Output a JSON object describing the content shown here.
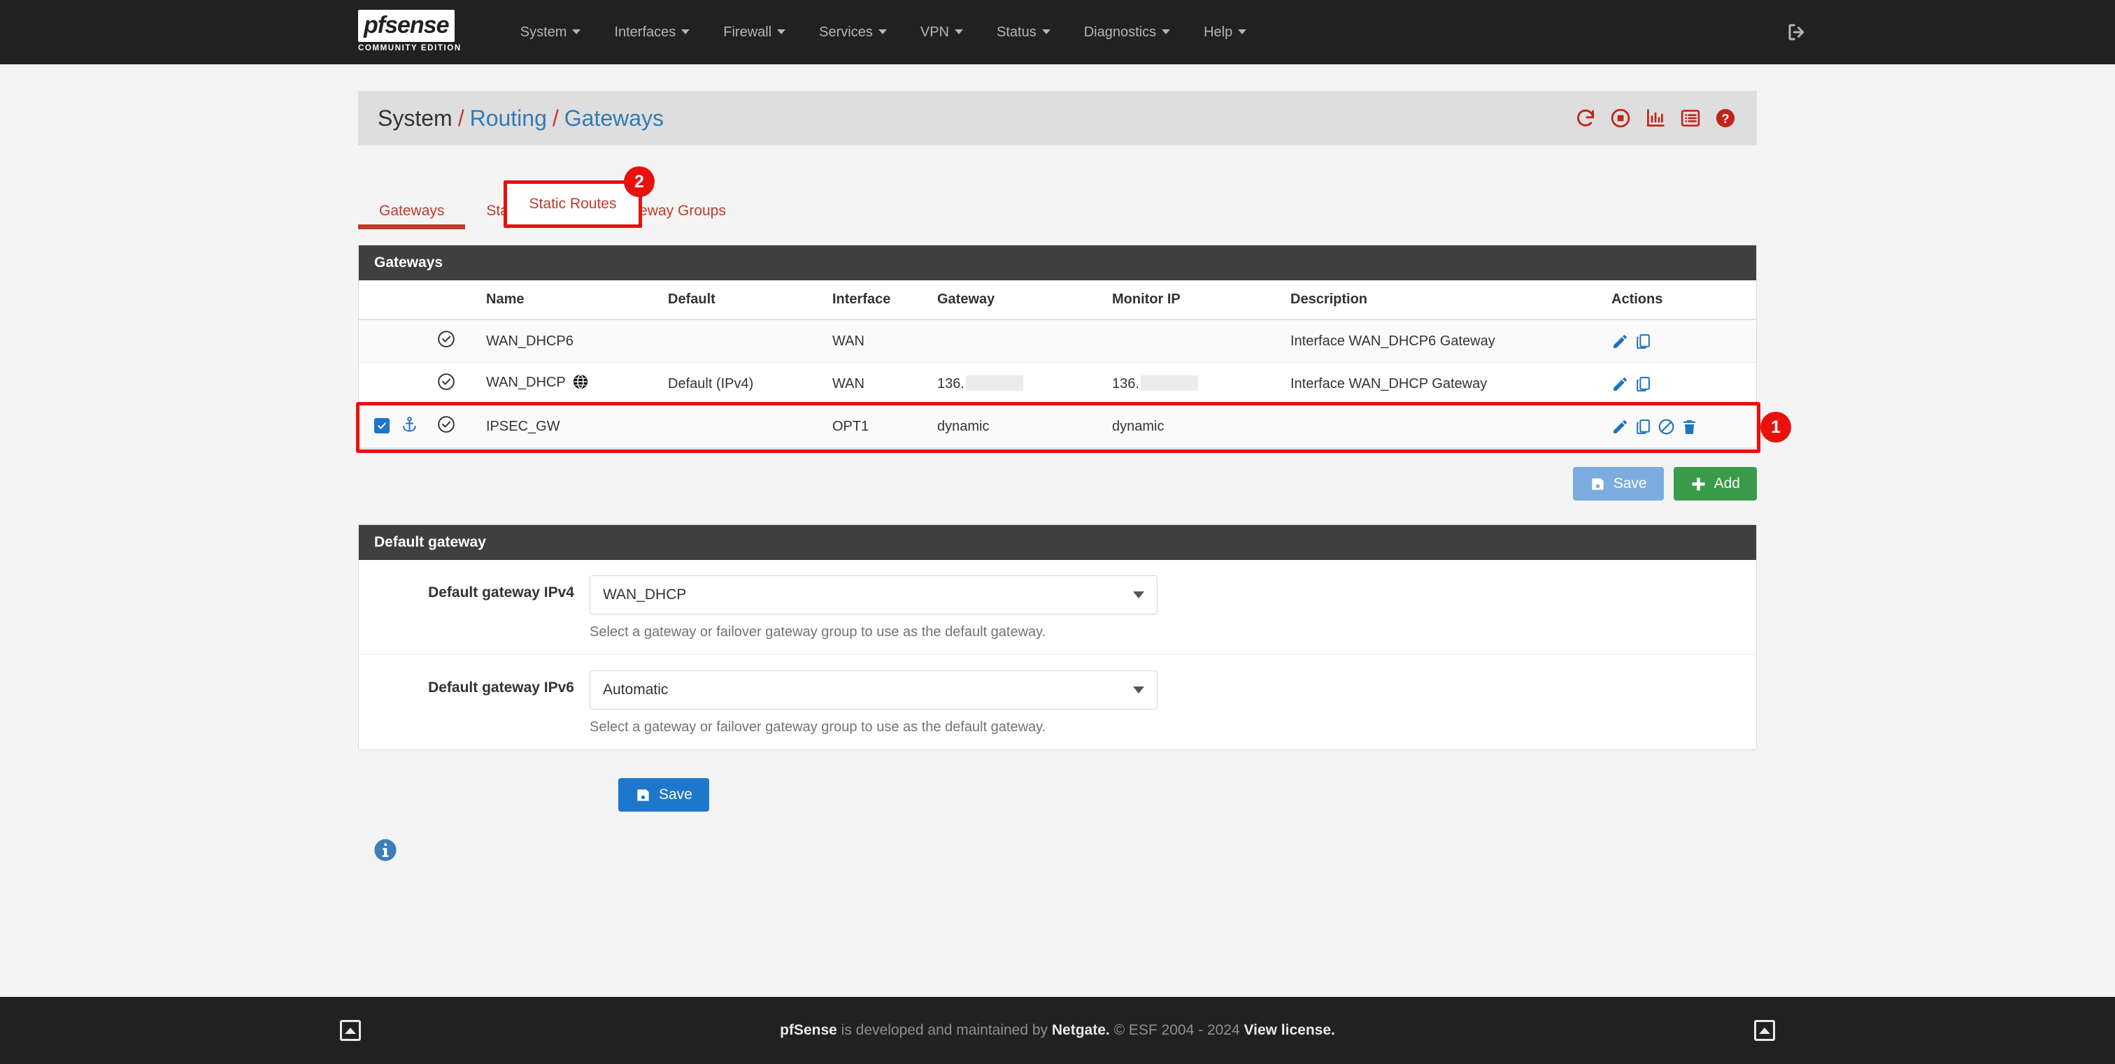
{
  "navbar": {
    "logo_text": "pfsense",
    "logo_sub": "COMMUNITY EDITION",
    "items": [
      {
        "label": "System"
      },
      {
        "label": "Interfaces"
      },
      {
        "label": "Firewall"
      },
      {
        "label": "Services"
      },
      {
        "label": "VPN"
      },
      {
        "label": "Status"
      },
      {
        "label": "Diagnostics"
      },
      {
        "label": "Help"
      }
    ],
    "logout_icon": "logout-icon"
  },
  "breadcrumb": {
    "root": "System",
    "sep": "/",
    "level2": "Routing",
    "level3": "Gateways",
    "icons": [
      {
        "name": "reload-icon"
      },
      {
        "name": "stop-icon"
      },
      {
        "name": "chart-icon"
      },
      {
        "name": "log-icon"
      },
      {
        "name": "help-icon"
      }
    ]
  },
  "tabs": [
    {
      "label": "Gateways",
      "active": true
    },
    {
      "label": "Static Routes",
      "active": false
    },
    {
      "label": "Gateway Groups",
      "active": false
    }
  ],
  "annotations": [
    {
      "number": "1",
      "target": "ipsec-gw-row"
    },
    {
      "number": "2",
      "target": "static-routes-tab"
    }
  ],
  "gateways_panel": {
    "title": "Gateways",
    "columns": [
      "",
      "",
      "",
      "Name",
      "Default",
      "Interface",
      "Gateway",
      "Monitor IP",
      "Description",
      "Actions"
    ],
    "column_headers": {
      "name": "Name",
      "default": "Default",
      "interface": "Interface",
      "gateway": "Gateway",
      "monitor_ip": "Monitor IP",
      "description": "Description",
      "actions": "Actions"
    },
    "rows": [
      {
        "checked": false,
        "anchor": false,
        "status": "status-ok-icon",
        "name": "WAN_DHCP6",
        "globe": false,
        "default": "",
        "interface": "WAN",
        "gateway": "",
        "gateway_redacted": false,
        "monitor_ip": "",
        "monitor_redacted": false,
        "description": "Interface WAN_DHCP6 Gateway",
        "actions": [
          "edit-icon",
          "copy-icon"
        ]
      },
      {
        "checked": false,
        "anchor": false,
        "status": "status-ok-icon",
        "name": "WAN_DHCP",
        "globe": true,
        "default": "Default (IPv4)",
        "interface": "WAN",
        "gateway": "136.",
        "gateway_redacted": true,
        "monitor_ip": "136.",
        "monitor_redacted": true,
        "description": "Interface WAN_DHCP Gateway",
        "actions": [
          "edit-icon",
          "copy-icon"
        ]
      },
      {
        "checked": true,
        "anchor": true,
        "status": "status-ok-icon",
        "name": "IPSEC_GW",
        "globe": false,
        "default": "",
        "interface": "OPT1",
        "gateway": "dynamic",
        "gateway_redacted": false,
        "monitor_ip": "dynamic",
        "monitor_redacted": false,
        "description": "",
        "actions": [
          "edit-icon",
          "copy-icon",
          "disable-icon",
          "delete-icon"
        ]
      }
    ],
    "save_label": "Save",
    "add_label": "Add"
  },
  "default_gateway_panel": {
    "title": "Default gateway",
    "ipv4": {
      "label": "Default gateway IPv4",
      "value": "WAN_DHCP",
      "help": "Select a gateway or failover gateway group to use as the default gateway."
    },
    "ipv6": {
      "label": "Default gateway IPv6",
      "value": "Automatic",
      "help": "Select a gateway or failover gateway group to use as the default gateway."
    }
  },
  "bottom": {
    "save_label": "Save",
    "info_icon": "info-icon"
  },
  "footer": {
    "brand": "pfSense",
    "mid": " is developed and maintained by ",
    "company": "Netgate.",
    "copyright": " © ESF 2004 - 2024 ",
    "license": "View license."
  },
  "colors": {
    "navbar_bg": "#212121",
    "accent_red": "#c0392b",
    "annotation_red": "#e8110e",
    "link_blue": "#337ab7",
    "icon_blue": "#2074cc",
    "panel_heading": "#3f3f3f",
    "page_bg": "#f4f4f4",
    "success_green": "#3a9b4a"
  }
}
